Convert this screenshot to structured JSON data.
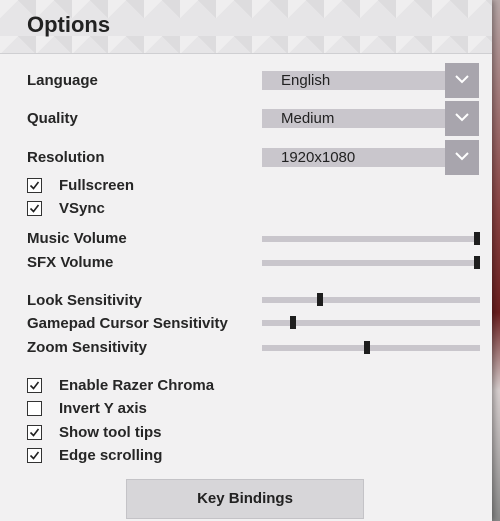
{
  "window": {
    "title": "Options"
  },
  "dropdowns": [
    {
      "label": "Language",
      "value": "English"
    },
    {
      "label": "Quality",
      "value": "Medium"
    },
    {
      "label": "Resolution",
      "value": "1920x1080"
    }
  ],
  "display_checks": [
    {
      "label": "Fullscreen",
      "checked": true
    },
    {
      "label": "VSync",
      "checked": true
    }
  ],
  "volume_sliders": [
    {
      "label": "Music Volume",
      "value": 1.0
    },
    {
      "label": "SFX Volume",
      "value": 1.0
    }
  ],
  "sensitivity_sliders": [
    {
      "label": "Look Sensitivity",
      "value": 0.26
    },
    {
      "label": "Gamepad Cursor Sensitivity",
      "value": 0.13
    },
    {
      "label": "Zoom Sensitivity",
      "value": 0.48
    }
  ],
  "extra_checks": [
    {
      "label": "Enable Razer Chroma",
      "checked": true
    },
    {
      "label": "Invert Y axis",
      "checked": false
    },
    {
      "label": "Show tool tips",
      "checked": true
    },
    {
      "label": "Edge scrolling",
      "checked": true
    }
  ],
  "buttons": {
    "key_bindings": "Key Bindings"
  },
  "icons": {
    "dropdown_arrow": "chevron-down-icon",
    "check": "checkmark-icon"
  }
}
